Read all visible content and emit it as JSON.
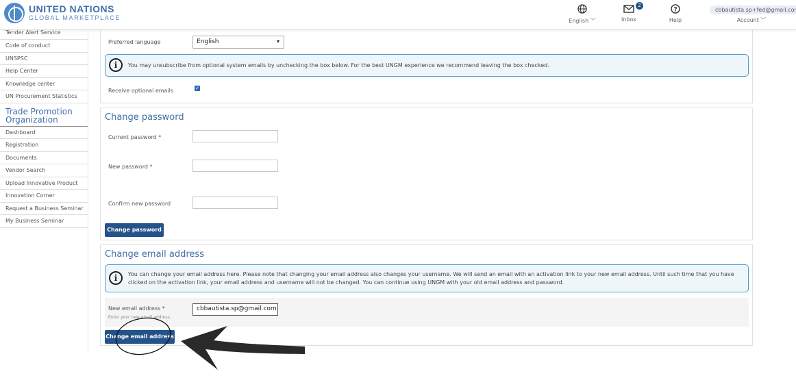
{
  "header": {
    "logo_line1": "UNITED NATIONS",
    "logo_line2": "GLOBAL MARKETPLACE",
    "language_label": "English ﹀",
    "inbox_label": "Inbox",
    "inbox_count": "2",
    "help_label": "Help",
    "account_email": "cbbautista.sp+fed@gmail.com",
    "account_label": "Account ﹀"
  },
  "sidebar": {
    "top_items": [
      "Tender Alert Service",
      "Code of conduct",
      "UNSPSC",
      "Help Center",
      "Knowledge center",
      "UN Procurement Statistics"
    ],
    "section_title": "Trade Promotion Organization",
    "section_items": [
      "Dashboard",
      "Registration",
      "Documents",
      "Vendor Search",
      "Upload Innovative Product",
      "Innovation Corner",
      "Request a Business Seminar",
      "My Business Seminar"
    ]
  },
  "preferences": {
    "language_label": "Preferred language",
    "language_value": "English",
    "info_text": "You may unsubscribe from optional system emails by unchecking the box below. For the best UNGM experience we recommend leaving the box checked.",
    "optional_emails_label": "Receive optional emails",
    "optional_emails_checked": true
  },
  "password": {
    "title": "Change password",
    "current_label": "Current password *",
    "new_label": "New password *",
    "confirm_label": "Confirm new password",
    "button": "Change password"
  },
  "email": {
    "title": "Change email address",
    "info_line1": "You can change your email address here. Please note that changing your email address also changes your username. We will send an email with an activation link to your new email address. Until such time that you have",
    "info_line2": "clicked on the activation link, your email address and username will not be changed. You can continue using UNGM with your old email address and password.",
    "new_label": "New email address *",
    "hint": "Enter your new email address.",
    "new_value": "cbbautista.sp@gmail.com",
    "button": "Change email address"
  },
  "icons": {
    "globe": "globe-icon",
    "inbox": "inbox-icon",
    "help": "help-icon",
    "info": "info-icon",
    "arrow": "annotation-arrow-icon"
  },
  "colors": {
    "brand": "#24538a",
    "accent": "#3f6faa",
    "info_border": "#4e9dd1"
  }
}
